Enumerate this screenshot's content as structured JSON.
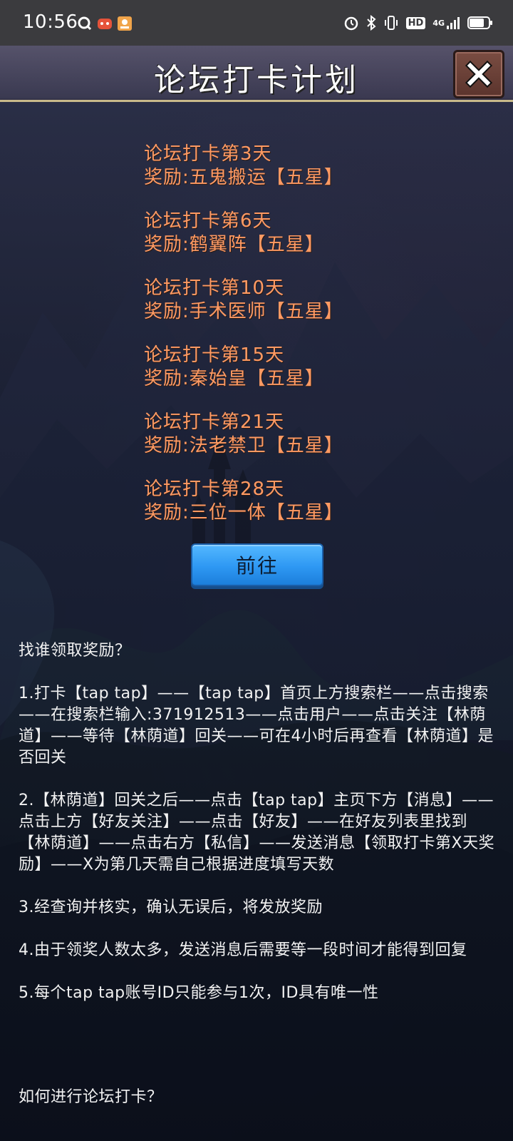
{
  "status_bar": {
    "time": "10:56",
    "notification_icons": [
      "q-app-icon",
      "game-controller-icon",
      "photo-app-icon"
    ],
    "right_icons": [
      "alarm-icon",
      "bluetooth-icon",
      "vibrate-icon",
      "hd-icon",
      "4g-signal-icon",
      "battery-icon"
    ],
    "hd_label": "HD",
    "network_label": "4G"
  },
  "header": {
    "title": "论坛打卡计划",
    "close_icon": "close-x-icon"
  },
  "rewards": [
    {
      "day": "论坛打卡第3天",
      "reward": "奖励:五鬼搬运【五星】"
    },
    {
      "day": "论坛打卡第6天",
      "reward": "奖励:鹤翼阵【五星】"
    },
    {
      "day": "论坛打卡第10天",
      "reward": "奖励:手术医师【五星】"
    },
    {
      "day": "论坛打卡第15天",
      "reward": "奖励:秦始皇【五星】"
    },
    {
      "day": "论坛打卡第21天",
      "reward": "奖励:法老禁卫【五星】"
    },
    {
      "day": "论坛打卡第28天",
      "reward": "奖励:三位一体【五星】"
    }
  ],
  "go_button": "前往",
  "instructions": {
    "heading": "找谁领取奖励？",
    "steps": [
      "1.打卡【tap tap】——【tap tap】首页上方搜索栏——点击搜索——在搜索栏输入:371912513——点击用户——点击关注【林荫道】——等待【林荫道】回关——可在4小时后再查看【林荫道】是否回关",
      "2.【林荫道】回关之后——点击【tap tap】主页下方【消息】——点击上方【好友关注】——点击【好友】——在好友列表里找到【林荫道】——点击右方【私信】——发送消息【领取打卡第X天奖励】——X为第几天需自己根据进度填写天数",
      "3.经查询并核实，确认无误后，将发放奖励",
      "4.由于领奖人数太多，发送消息后需要等一段时间才能得到回复",
      "5.每个tap tap账号ID只能参与1次，ID具有唯一性"
    ],
    "second_heading": "如何进行论坛打卡？"
  },
  "colors": {
    "reward_text": "#ff9a63",
    "button_blue": "#2e98f3",
    "title_bar_border": "#c9b98a",
    "close_button": "#6b3f36"
  }
}
